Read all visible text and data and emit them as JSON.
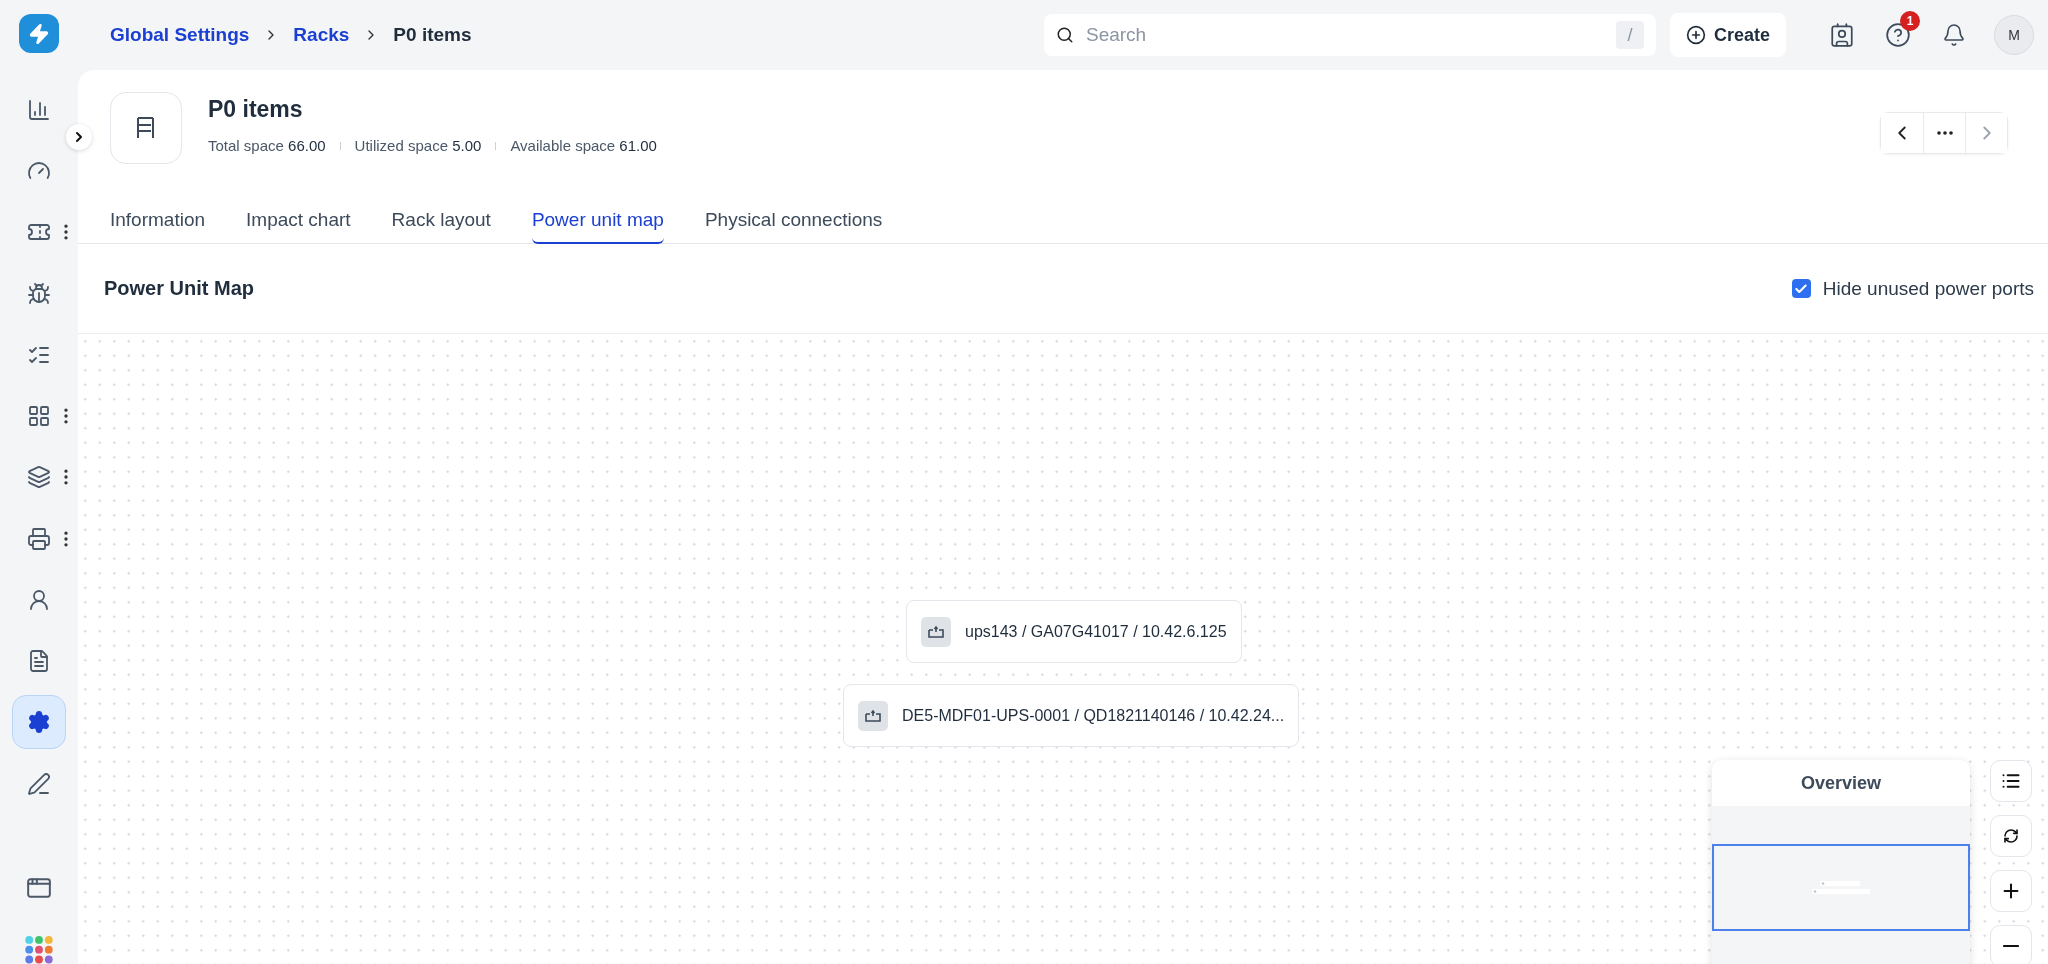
{
  "breadcrumbs": [
    {
      "label": "Global Settings",
      "link": true
    },
    {
      "label": "Racks",
      "link": true
    },
    {
      "label": "P0 items",
      "link": false
    }
  ],
  "search": {
    "placeholder": "Search",
    "shortcut": "/"
  },
  "create_button": "Create",
  "help_badge": "1",
  "avatar": "M",
  "sidebar": {
    "items": [
      {
        "selected": false,
        "menu": false
      },
      {
        "selected": false,
        "menu": false
      },
      {
        "selected": false,
        "menu": true
      },
      {
        "selected": false,
        "menu": false
      },
      {
        "selected": false,
        "menu": false
      },
      {
        "selected": false,
        "menu": true
      },
      {
        "selected": false,
        "menu": true
      },
      {
        "selected": false,
        "menu": true
      },
      {
        "selected": false,
        "menu": false
      },
      {
        "selected": false,
        "menu": false
      },
      {
        "selected": true,
        "menu": false
      },
      {
        "selected": false,
        "menu": false
      }
    ]
  },
  "header": {
    "title": "P0 items",
    "stats": [
      {
        "label": "Total space",
        "value": "66.00"
      },
      {
        "label": "Utilized space",
        "value": "5.00"
      },
      {
        "label": "Available space",
        "value": "61.00"
      }
    ]
  },
  "tabs": [
    {
      "label": "Information",
      "selected": false
    },
    {
      "label": "Impact chart",
      "selected": false
    },
    {
      "label": "Rack layout",
      "selected": false
    },
    {
      "label": "Power unit map",
      "selected": true
    },
    {
      "label": "Physical connections",
      "selected": false
    }
  ],
  "section": {
    "title": "Power Unit Map",
    "hide_unused": {
      "label": "Hide unused power ports",
      "checked": true
    }
  },
  "nodes": [
    {
      "label": "ups143 / GA07G41017 / 10.42.6.125"
    },
    {
      "label": "DE5-MDF01-UPS-0001 / QD1821140146 / 10.42.24..."
    }
  ],
  "overview": {
    "title": "Overview"
  }
}
